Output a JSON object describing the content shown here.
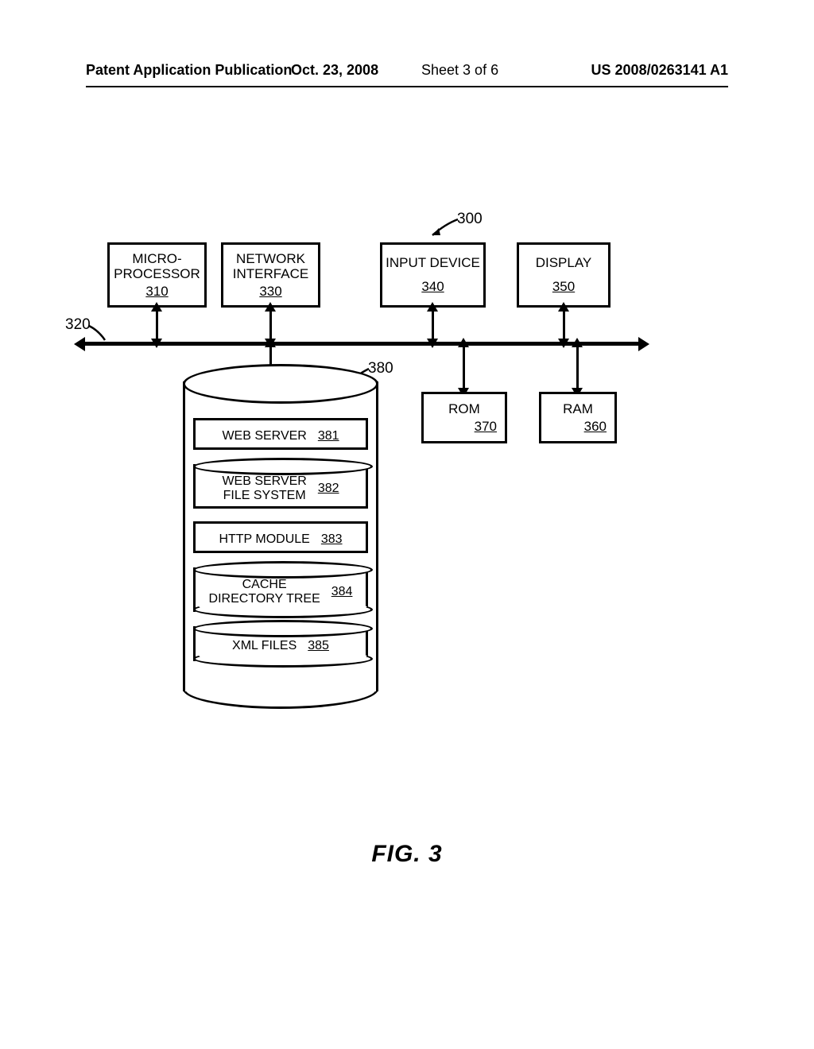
{
  "header": {
    "left": "Patent Application Publication",
    "date": "Oct. 23, 2008",
    "sheet": "Sheet 3 of 6",
    "pubno": "US 2008/0263141 A1"
  },
  "refs": {
    "system": "300",
    "bus": "320",
    "storage": "380"
  },
  "boxes": {
    "micro": {
      "line1": "MICRO-",
      "line2": "PROCESSOR",
      "ref": "310"
    },
    "netif": {
      "line1": "NETWORK",
      "line2": "INTERFACE",
      "ref": "330"
    },
    "input": {
      "line1": "INPUT DEVICE",
      "line2": "",
      "ref": "340"
    },
    "display": {
      "line1": "DISPLAY",
      "line2": "",
      "ref": "350"
    },
    "rom": {
      "line1": "ROM",
      "line2": "",
      "ref": "370"
    },
    "ram": {
      "line1": "RAM",
      "line2": "",
      "ref": "360"
    }
  },
  "storage_items": [
    {
      "label": "WEB SERVER",
      "ref": "381"
    },
    {
      "label": "WEB SERVER\nFILE SYSTEM",
      "ref": "382"
    },
    {
      "label": "HTTP MODULE",
      "ref": "383"
    },
    {
      "label": "CACHE\nDIRECTORY TREE",
      "ref": "384"
    },
    {
      "label": "XML FILES",
      "ref": "385"
    }
  ],
  "figure_caption": "FIG.  3"
}
